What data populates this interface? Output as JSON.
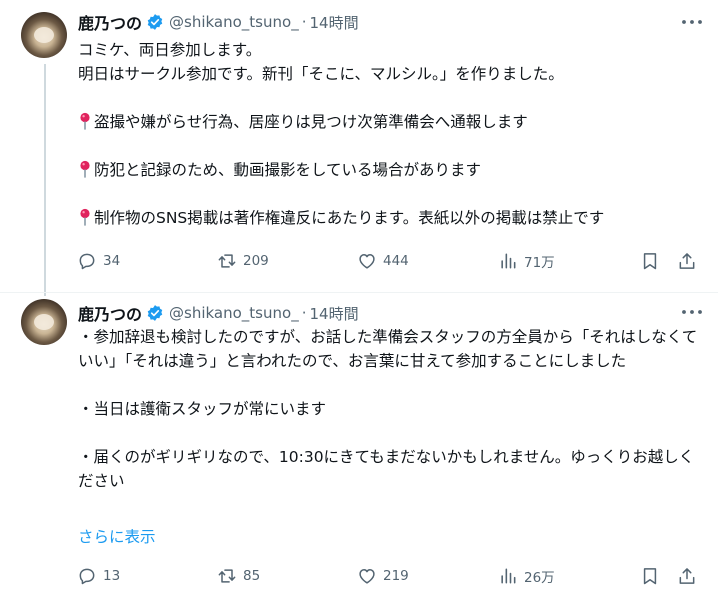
{
  "tweets": [
    {
      "author": {
        "name": "鹿乃つの",
        "handle": "@shikano_tsuno_",
        "separator": "·",
        "time": "14時間"
      },
      "lines": [
        "コミケ、両日参加します。",
        "明日はサークル参加です。新刊「そこに、マルシル。」を作りました。",
        "",
        "盗撮や嫌がらせ行為、居座りは見つけ次第準備会へ通報します",
        "",
        "防犯と記録のため、動画撮影をしている場合があります",
        "",
        "制作物のSNS掲載は著作権違反にあたります。表紙以外の掲載は禁止です"
      ],
      "stats": {
        "replies": "34",
        "reposts": "209",
        "likes": "444",
        "views": "71万"
      }
    },
    {
      "author": {
        "name": "鹿乃つの",
        "handle": "@shikano_tsuno_",
        "separator": "·",
        "time": "14時間"
      },
      "paragraphs": [
        "・参加辞退も検討したのですが、お話した準備会スタッフの方全員から「それはしなくていい」「それは違う」と言われたので、お言葉に甘えて参加することにしました",
        "・当日は護衛スタッフが常にいます",
        "・届くのがギリギリなので、10:30にきてもまだないかもしれません。ゆっくりお越しください"
      ],
      "show_more": "さらに表示",
      "stats": {
        "replies": "13",
        "reposts": "85",
        "likes": "219",
        "views": "26万"
      }
    }
  ],
  "icons": {
    "pin": "round-pushpin-icon",
    "verified": "verified-badge-icon",
    "more": "more-horizontal-icon",
    "reply": "reply-icon",
    "repost": "repost-icon",
    "like": "like-icon",
    "views": "views-icon",
    "bookmark": "bookmark-icon",
    "share": "share-icon"
  },
  "colors": {
    "accent": "#1d9bf0",
    "text": "#0f1419",
    "secondary": "#536471",
    "thread_line": "#cfd9de",
    "pin": "#e0245e"
  }
}
